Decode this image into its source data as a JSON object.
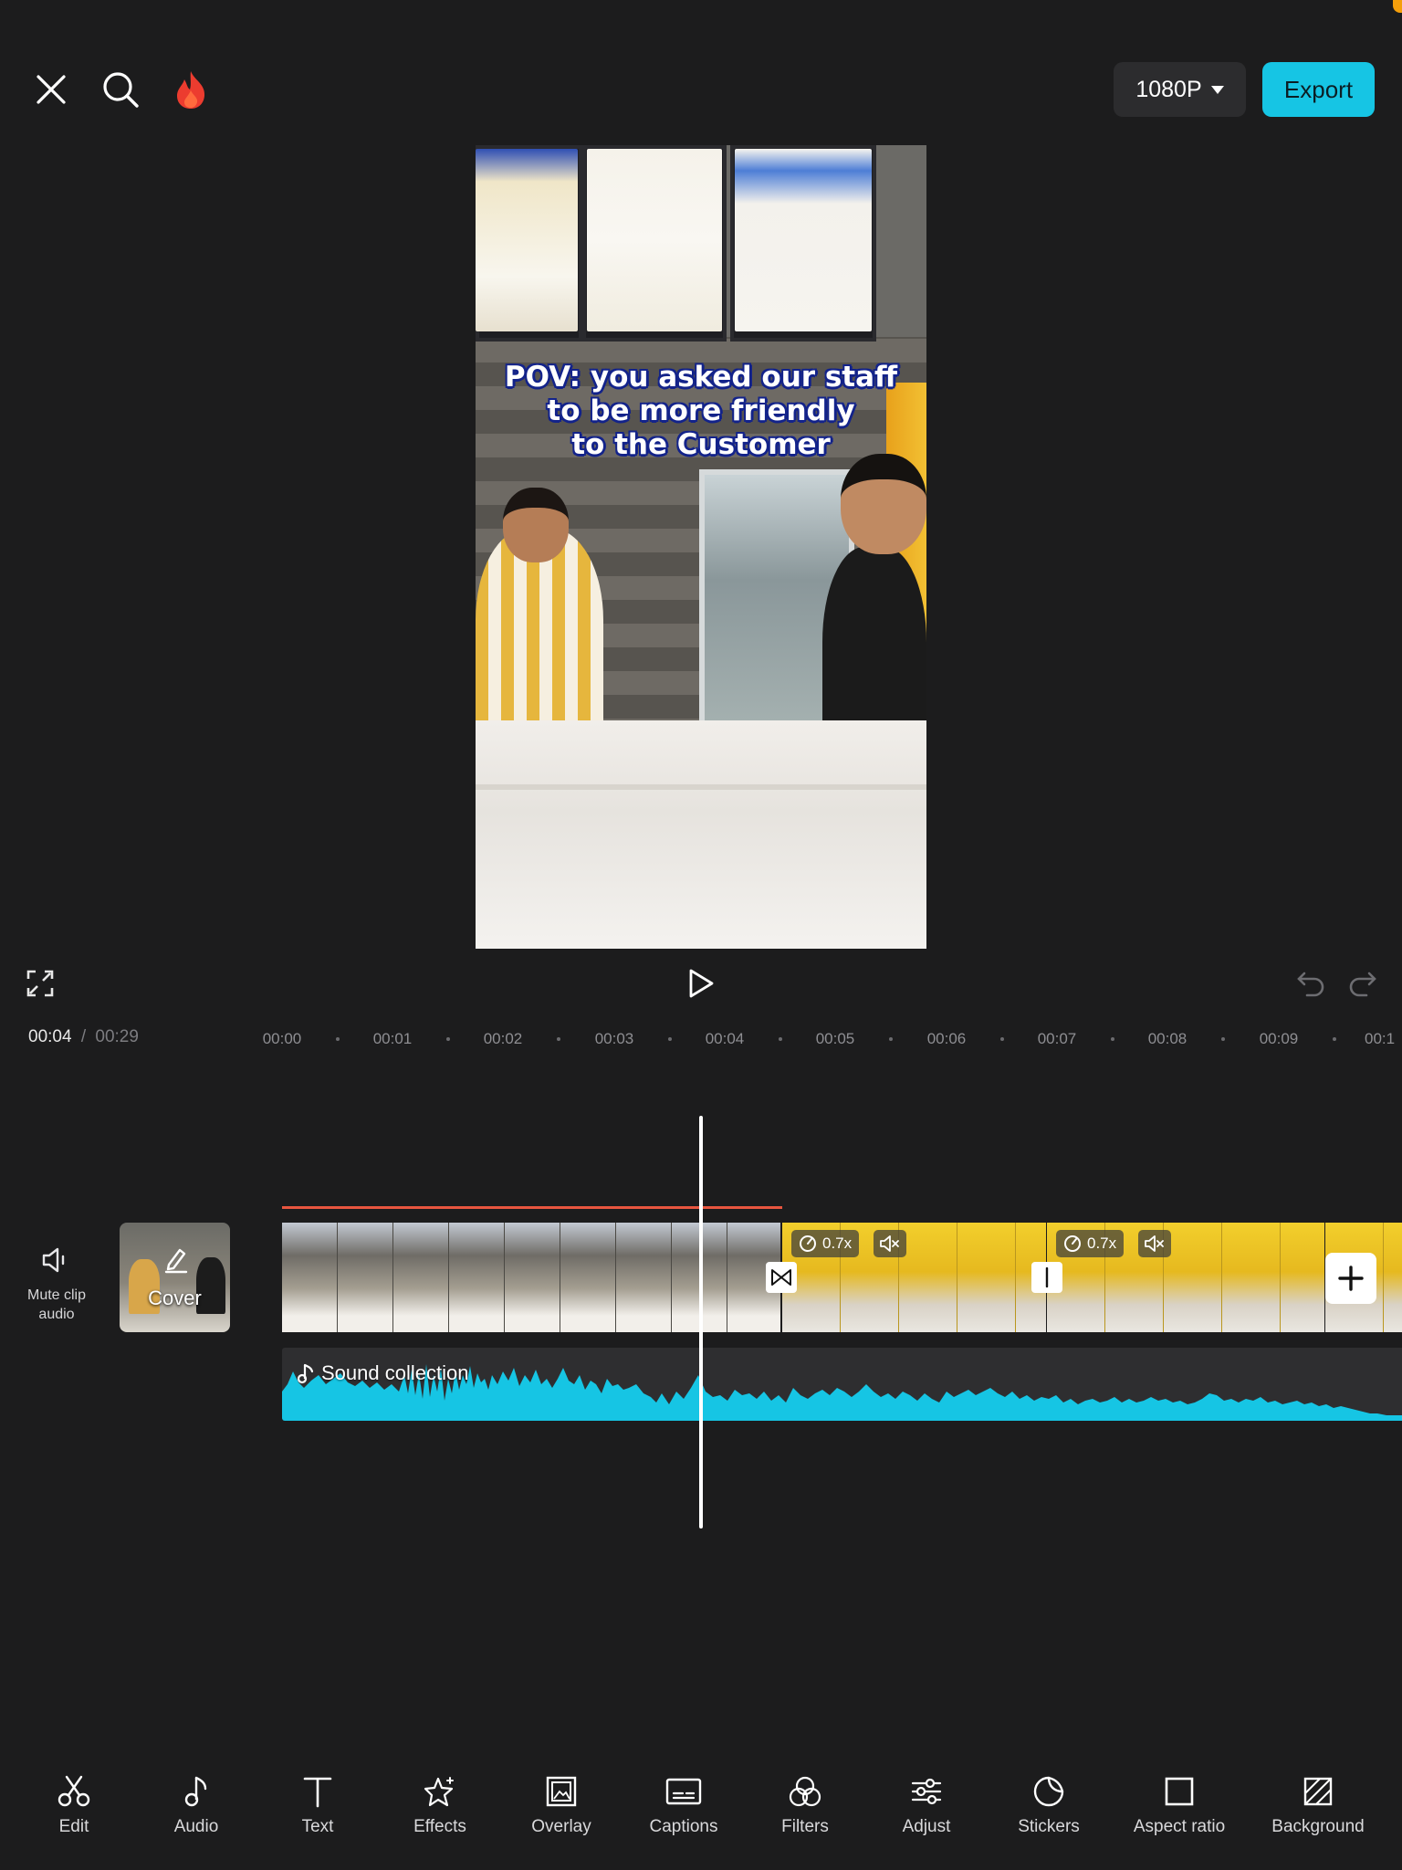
{
  "header": {
    "resolution_label": "1080P",
    "export_label": "Export"
  },
  "preview": {
    "caption_lines": [
      "POV: you asked our staff",
      "to be more friendly",
      "to the Customer"
    ]
  },
  "playback": {
    "current_time": "00:04",
    "separator": "/",
    "total_time": "00:29"
  },
  "ruler": {
    "ticks": [
      "00:00",
      "00:01",
      "00:02",
      "00:03",
      "00:04",
      "00:05",
      "00:06",
      "00:07",
      "00:08",
      "00:09",
      "00:1"
    ]
  },
  "timeline": {
    "mute_label": "Mute clip audio",
    "cover_label": "Cover",
    "clips": [
      {
        "speed": ""
      },
      {
        "speed": "0.7x"
      },
      {
        "speed": "0.7x"
      }
    ],
    "audio_label": "Sound collection",
    "accent_color": "#16c5e4"
  },
  "toolbar": {
    "items": [
      {
        "label": "Edit",
        "icon": "scissors-icon"
      },
      {
        "label": "Audio",
        "icon": "music-note-icon"
      },
      {
        "label": "Text",
        "icon": "text-icon"
      },
      {
        "label": "Effects",
        "icon": "sparkle-star-icon"
      },
      {
        "label": "Overlay",
        "icon": "overlay-image-icon"
      },
      {
        "label": "Captions",
        "icon": "captions-icon"
      },
      {
        "label": "Filters",
        "icon": "filters-icon"
      },
      {
        "label": "Adjust",
        "icon": "sliders-icon"
      },
      {
        "label": "Stickers",
        "icon": "sticker-icon"
      },
      {
        "label": "Aspect ratio",
        "icon": "aspect-ratio-icon"
      },
      {
        "label": "Background",
        "icon": "background-icon"
      }
    ]
  }
}
